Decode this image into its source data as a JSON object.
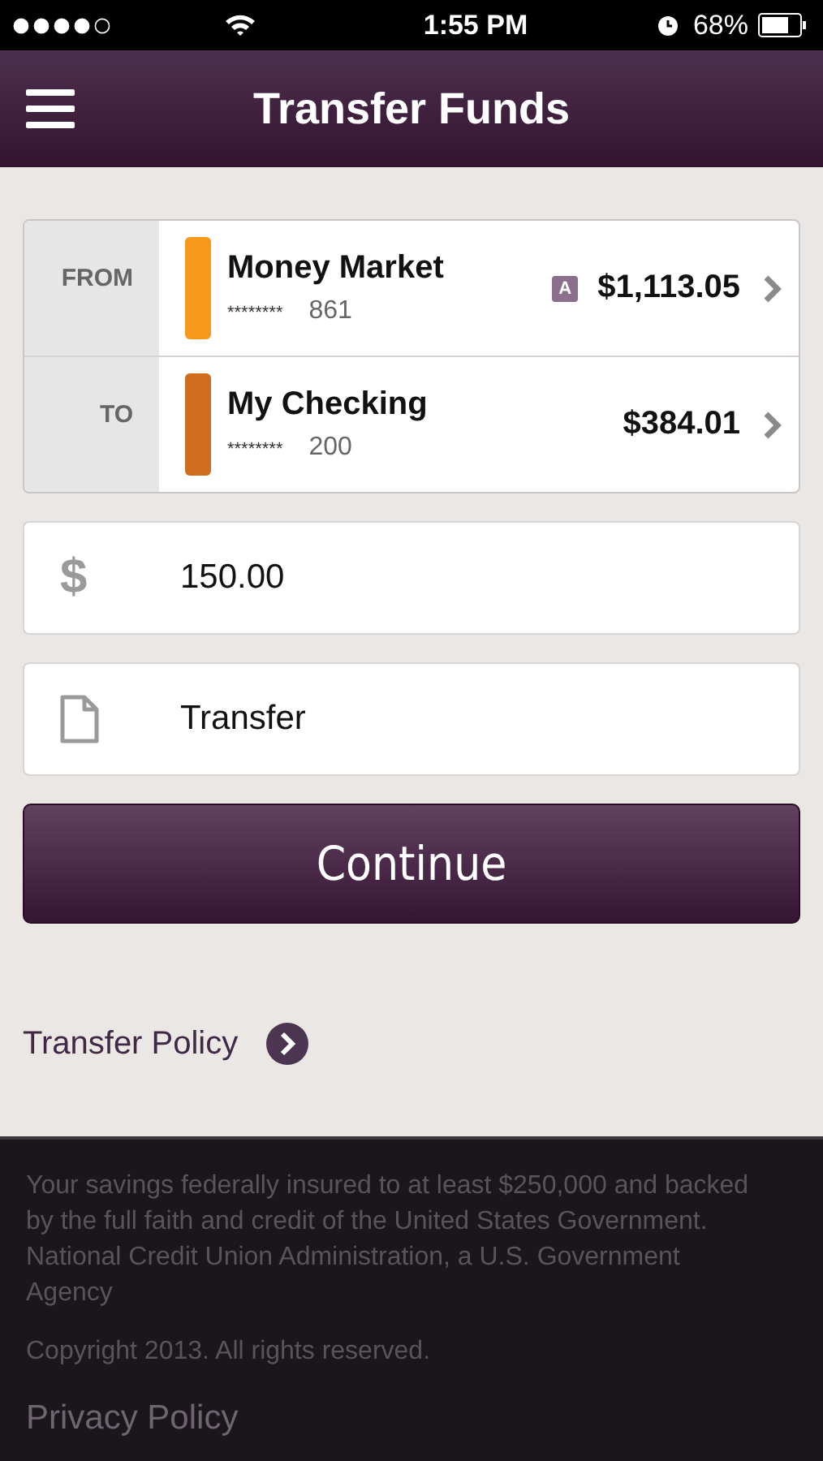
{
  "status_bar": {
    "time": "1:55 PM",
    "battery": "68%"
  },
  "header": {
    "title": "Transfer Funds"
  },
  "accounts": [
    {
      "label": "FROM",
      "color": "#f7981d",
      "name": "Money Market",
      "masked": "********",
      "last_digits": "861",
      "badge": "A",
      "balance": "$1,113.05"
    },
    {
      "label": "TO",
      "color": "#cf6c1d",
      "name": "My Checking",
      "masked": "********",
      "last_digits": "200",
      "balance": "$384.01"
    }
  ],
  "amount": {
    "symbol": "$",
    "value": "150.00"
  },
  "memo": {
    "value": "Transfer"
  },
  "continue_button": "Continue",
  "policy_link": "Transfer Policy",
  "footer": {
    "disclaimer": "Your savings federally insured to at least $250,000 and backed by the full faith and credit of the United States Government. National Credit Union Administration, a U.S. Government Agency",
    "copyright": "Copyright 2013. All rights reserved.",
    "privacy_link": "Privacy Policy"
  }
}
